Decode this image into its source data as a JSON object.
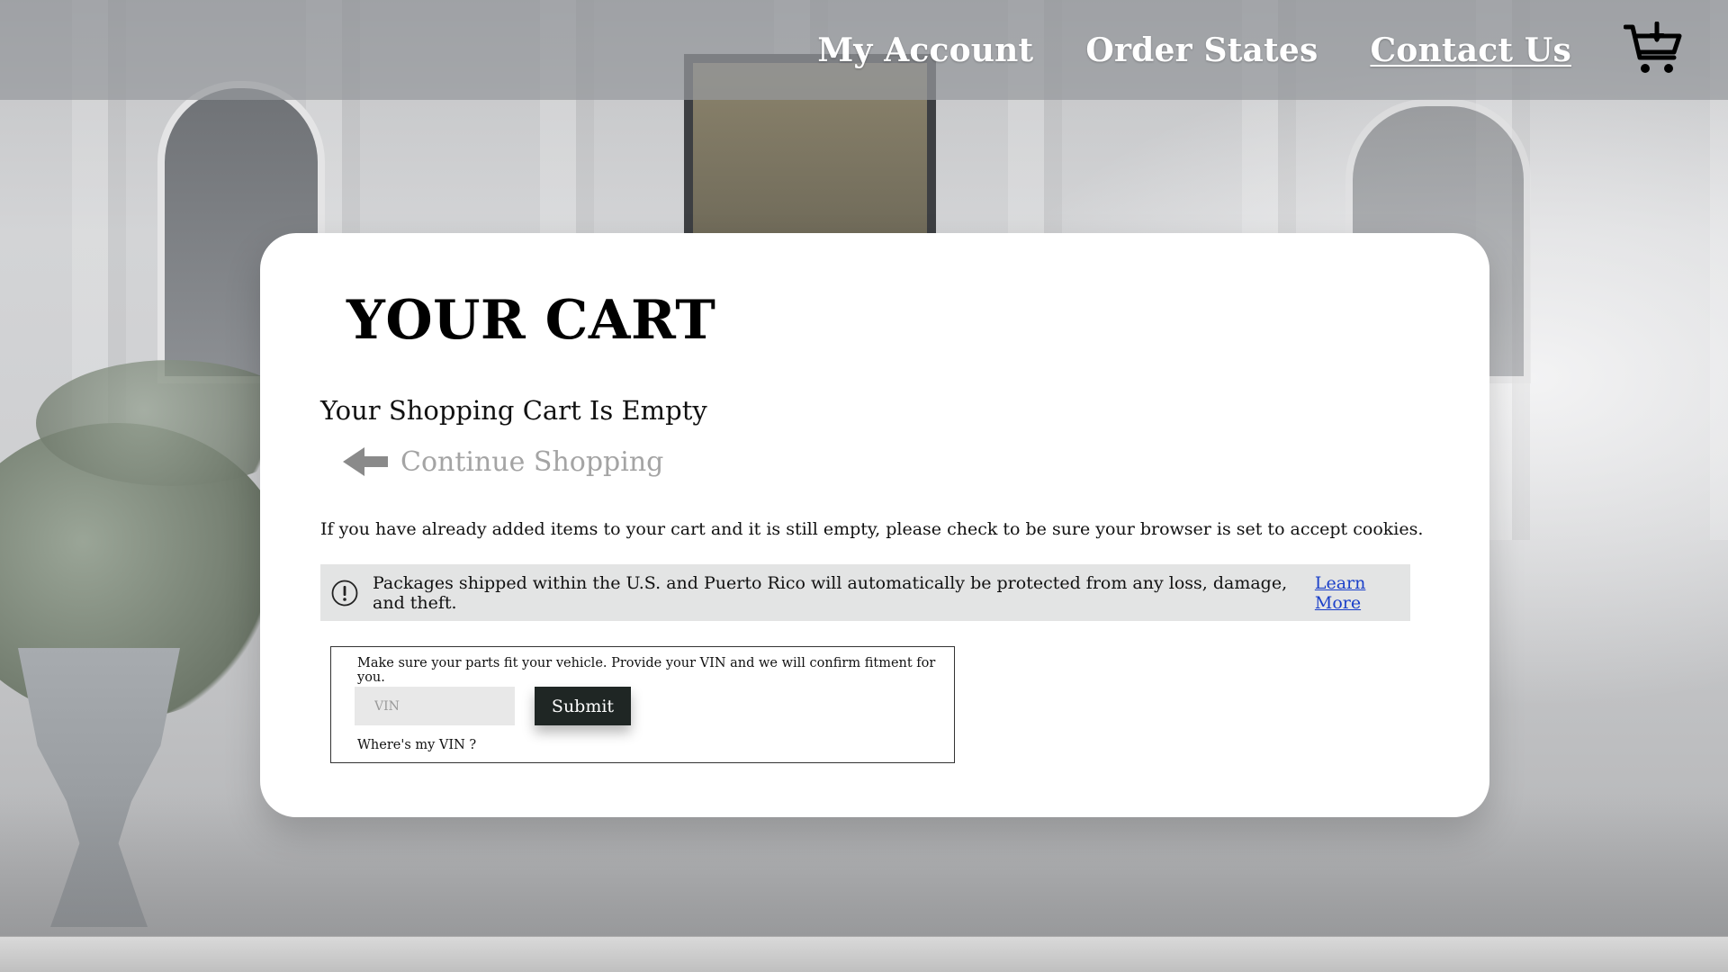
{
  "header": {
    "nav": [
      {
        "label": "My Account"
      },
      {
        "label": "Order States"
      },
      {
        "label": "Contact Us"
      }
    ],
    "cart_icon": "shopping-cart-icon"
  },
  "cart": {
    "title": "YOUR CART",
    "empty_message": "Your Shopping Cart Is Empty",
    "continue_label": "Continue Shopping",
    "continue_icon": "arrow-left-icon",
    "cookie_note": "If you have already added items to your cart and it is still empty, please check to be sure your browser is set to accept cookies.",
    "notice": {
      "icon": "exclamation-circle-icon",
      "text": "Packages shipped within the U.S. and Puerto Rico will automatically be protected from any loss, damage, and theft.",
      "link_label": "Learn More"
    }
  },
  "vin": {
    "hint": "Make sure your parts fit your vehicle. Provide your VIN and we will confirm fitment for you.",
    "placeholder": "VIN",
    "value": "",
    "submit_label": "Submit",
    "help_label": "Where's my VIN ?"
  },
  "colors": {
    "link": "#1a3fc9",
    "submit_bg": "#1f2624",
    "notice_bg": "#e3e4e4",
    "muted_link": "#a4a4a4"
  }
}
